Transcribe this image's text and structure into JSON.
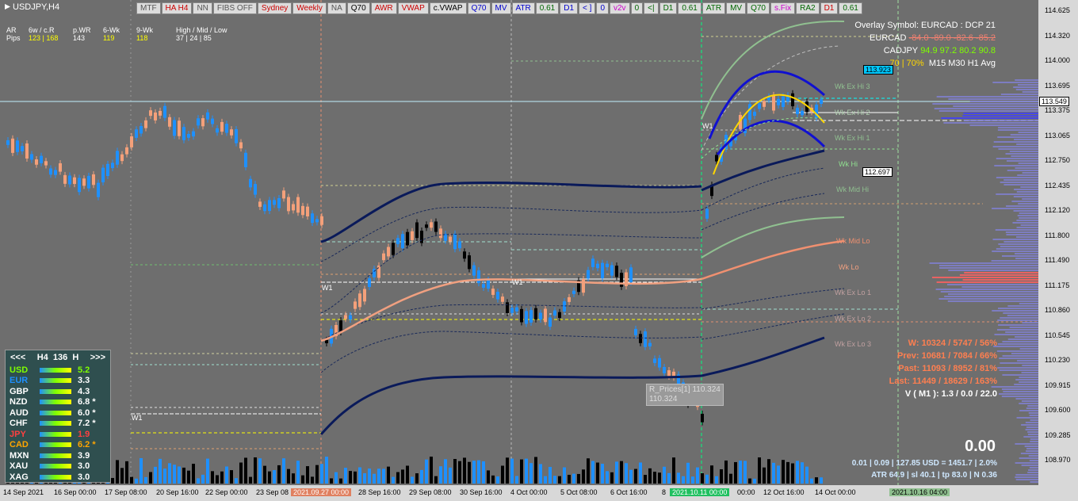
{
  "symbol": "USDJPY,H4",
  "toolbar": [
    {
      "label": "MTF",
      "color": "#555555"
    },
    {
      "label": "HA H4",
      "color": "#cc0000"
    },
    {
      "label": "NN",
      "color": "#555555"
    },
    {
      "label": "FIBS OFF",
      "color": "#555555"
    },
    {
      "label": "Sydney",
      "color": "#cc0000"
    },
    {
      "label": "Weekly",
      "color": "#cc0000"
    },
    {
      "label": "NA",
      "color": "#555555"
    },
    {
      "label": "Q70",
      "color": "#000000"
    },
    {
      "label": "AWR",
      "color": "#cc0000"
    },
    {
      "label": "VWAP",
      "color": "#cc0000"
    },
    {
      "label": "c.VWAP",
      "color": "#000000"
    },
    {
      "label": "Q70",
      "color": "#0000cc"
    },
    {
      "label": "MV",
      "color": "#0000cc"
    },
    {
      "label": "ATR",
      "color": "#0000cc"
    },
    {
      "label": "0.61",
      "color": "#006600"
    },
    {
      "label": "D1",
      "color": "#0000cc"
    },
    {
      "label": "< ]",
      "color": "#0000cc"
    },
    {
      "label": "0",
      "color": "#0000cc"
    },
    {
      "label": "v2v",
      "color": "#cc00cc"
    },
    {
      "label": "0",
      "color": "#006600"
    },
    {
      "label": "<|",
      "color": "#006600"
    },
    {
      "label": "D1",
      "color": "#006600"
    },
    {
      "label": "0.61",
      "color": "#006600"
    },
    {
      "label": "ATR",
      "color": "#006600"
    },
    {
      "label": "MV",
      "color": "#006600"
    },
    {
      "label": "Q70",
      "color": "#006600"
    },
    {
      "label": "s.Fix",
      "color": "#cc00cc"
    },
    {
      "label": "RA2",
      "color": "#006600"
    },
    {
      "label": "D1",
      "color": "#cc0000"
    },
    {
      "label": "0.61",
      "color": "#006600"
    }
  ],
  "stats": {
    "row_labels": [
      "AR",
      "Pips"
    ],
    "cols": [
      {
        "head": "6w / c.R",
        "val": "123 | 168"
      },
      {
        "head": "p.WR",
        "val": "143"
      },
      {
        "head": "6-Wk",
        "val": "119"
      },
      {
        "head": "9-Wk",
        "val": "118"
      },
      {
        "head": "High / Mid / Low",
        "val": "37  |  24  |  85"
      }
    ]
  },
  "overlay": {
    "title": "Overlay Symbol: EURCAD : DCP 21",
    "eurcad_label": "EURCAD",
    "eurcad_vals": "-84.0  -89.0  -82.6  -85.2",
    "cadjpy_label": "CADJPY",
    "cadjpy_vals": "94.9  97.2  80.2  90.8",
    "pct": "70 | 70%",
    "tfs": "M15   M30     H1   Avg"
  },
  "levels": [
    "Wk Ex Hi 3",
    "Wk Ex Hi 2",
    "Wk Ex Hi 1",
    "Wk Hi",
    "Wk Mid Hi",
    "Wk Mid Lo",
    "Wk Lo",
    "Wk Ex Lo 1",
    "Wk Ex Lo 2",
    "Wk Ex Lo 3"
  ],
  "weekly_stats": {
    "w": "W: 10324 / 5747 / 56%",
    "prev": "Prev: 10681 / 7084 / 66%",
    "past": "Past: 11093 / 8952 / 81%",
    "last": "Last: 11449 / 18629 / 163%",
    "v": "V ( M1 ): 1.3 / 0.0 / 22.0"
  },
  "big_value": "0.00",
  "bottom": {
    "line1": "0.01  |  0.09  |  127.85 USD = 1451.7  |  2.0%",
    "line2": "ATR 64.9  |  sl 40.1  |  tp 83.0  |  N 0.36"
  },
  "currency_panel": {
    "prev": "<<<",
    "tf": "H4",
    "count": "136",
    "mode": "H",
    "next": ">>>",
    "rows": [
      {
        "name": "USD",
        "value": "5.2",
        "color": "#7fff00",
        "vcolor": "#7fff00"
      },
      {
        "name": "EUR",
        "value": "3.3",
        "color": "#1e90ff",
        "vcolor": "#ffffff"
      },
      {
        "name": "GBP",
        "value": "4.3",
        "color": "#ffffff",
        "vcolor": "#ffffff"
      },
      {
        "name": "NZD",
        "value": "6.8 *",
        "color": "#ffffff",
        "vcolor": "#ffffff"
      },
      {
        "name": "AUD",
        "value": "6.0 *",
        "color": "#ffffff",
        "vcolor": "#ffffff"
      },
      {
        "name": "CHF",
        "value": "7.2 *",
        "color": "#ffffff",
        "vcolor": "#ffffff"
      },
      {
        "name": "JPY",
        "value": "1.9",
        "color": "#ff4040",
        "vcolor": "#ff4040"
      },
      {
        "name": "CAD",
        "value": "6.2 *",
        "color": "#ffa500",
        "vcolor": "#ffa500"
      },
      {
        "name": "MXN",
        "value": "3.9",
        "color": "#ffffff",
        "vcolor": "#ffffff"
      },
      {
        "name": "XAU",
        "value": "3.0",
        "color": "#ffffff",
        "vcolor": "#ffffff"
      },
      {
        "name": "XAG",
        "value": "3.0",
        "color": "#ffffff",
        "vcolor": "#ffffff"
      }
    ]
  },
  "price_ticks": [
    "114.625",
    "114.320",
    "114.000",
    "113.695",
    "113.375",
    "113.065",
    "112.750",
    "112.435",
    "112.120",
    "111.800",
    "111.490",
    "111.175",
    "110.860",
    "110.545",
    "110.230",
    "109.915",
    "109.600",
    "109.285",
    "108.970"
  ],
  "price_boxes": [
    {
      "label": "113.549",
      "bg": "#ffffff",
      "fg": "#000000"
    },
    {
      "label": "113.923",
      "bg": "#00c8ff",
      "fg": "#000000"
    },
    {
      "label": "112.697",
      "bg": "#ffffff",
      "fg": "#000000"
    }
  ],
  "time_labels": [
    "14 Sep 2021",
    "16 Sep 00:00",
    "17 Sep 08:00",
    "20 Sep 16:00",
    "22 Sep 00:00",
    "23 Sep 08",
    "2021.09.27 00:00",
    "28 Sep 16:00",
    "29 Sep 08:00",
    "30 Sep 16:00",
    "4 Oct 00:00",
    "5 Oct 08:00",
    "6 Oct 16:00",
    "8",
    "2021.10.11 00:00",
    "00:00",
    "12 Oct 16:00",
    "14 Oct 00:00",
    "2021.10.16 04:00"
  ],
  "chart_labels": {
    "w1": "W1",
    "tooltip_line1": "R_Prices[1] 110.324",
    "tooltip_line2": "110.324"
  }
}
